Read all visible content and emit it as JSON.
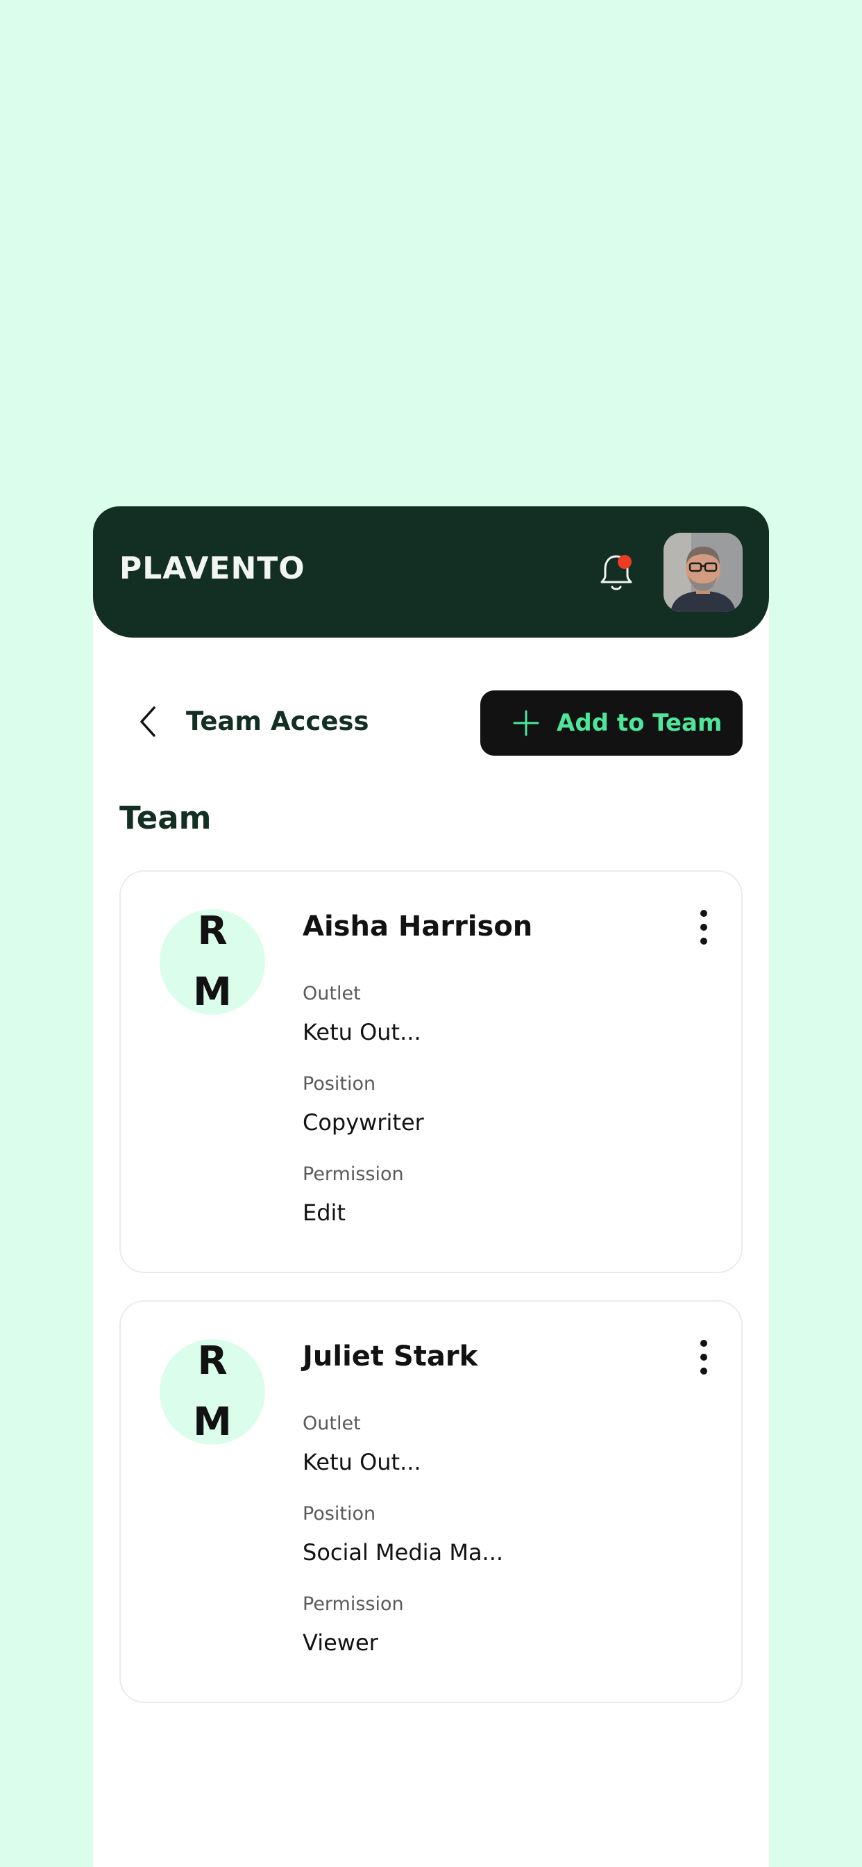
{
  "header": {
    "brand": "PLAVENTO",
    "icons": {
      "notification": "bell-icon",
      "avatar": "user-avatar"
    },
    "colors": {
      "background": "#132e22",
      "notification_dot": "#ee3b24"
    }
  },
  "subbar": {
    "back_icon": "chevron-left-icon",
    "title": "Team Access",
    "add_button": {
      "icon": "plus-icon",
      "label": "Add to Team"
    }
  },
  "section": {
    "title": "Team"
  },
  "members": [
    {
      "initials_line1": "R",
      "initials_line2": "M",
      "name": "Aisha Harrison",
      "outlet_label": "Outlet",
      "outlet": "Ketu Out...",
      "position_label": "Position",
      "position": "Copywriter",
      "permission_label": "Permission",
      "permission": "Edit"
    },
    {
      "initials_line1": "R",
      "initials_line2": "M",
      "name": "Juliet Stark",
      "outlet_label": "Outlet",
      "outlet": "Ketu Out...",
      "position_label": "Position",
      "position": "Social Media Ma...",
      "permission_label": "Permission",
      "permission": "Viewer"
    }
  ],
  "theme": {
    "page_background": "#dbfdec",
    "accent_green": "#4de69b",
    "button_dark": "#121212"
  }
}
